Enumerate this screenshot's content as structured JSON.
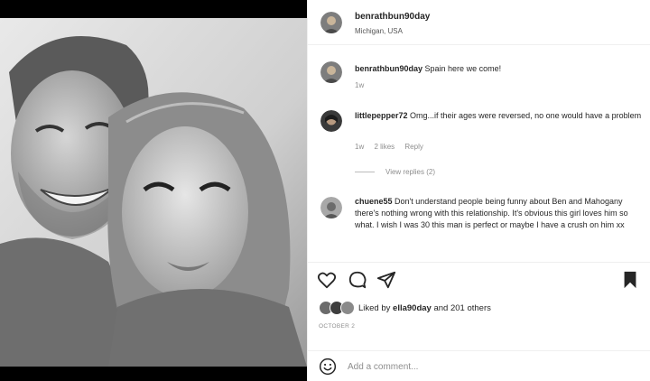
{
  "post": {
    "author": "benrathbun90day",
    "location": "Michigan, USA",
    "photo_alt": "Black and white selfie of a smiling man and woman",
    "date": "OCTOBER 2"
  },
  "comments": [
    {
      "username": "benrathbun90day",
      "text": "Spain here we come!",
      "time": "1w",
      "likes": "",
      "reply": ""
    },
    {
      "username": "littlepepper72",
      "text": "Omg...if their ages were reversed, no one would have a problem",
      "time": "1w",
      "likes": "2 likes",
      "reply": "Reply"
    },
    {
      "username": "chuene55",
      "text": "Don't understand people being funny about Ben and Mahogany there's nothing wrong with this relationship. It's obvious this girl loves him so what. I wish I was 30 this man is perfect or maybe I have a crush on him xx",
      "time": "",
      "likes": "",
      "reply": ""
    }
  ],
  "view_replies": "View replies (2)",
  "likes": {
    "prefix": "Liked by",
    "user": "ella90day",
    "suffix": "and 201 others"
  },
  "add_comment": {
    "placeholder": "Add a comment..."
  },
  "icons": {
    "like": "heart-icon",
    "comment": "comment-bubble-icon",
    "share": "send-icon",
    "save": "bookmark-icon",
    "emoji": "emoji-smile-icon"
  },
  "colors": {
    "text": "#262626",
    "secondary": "#8e8e8e",
    "divider": "#efefef"
  }
}
